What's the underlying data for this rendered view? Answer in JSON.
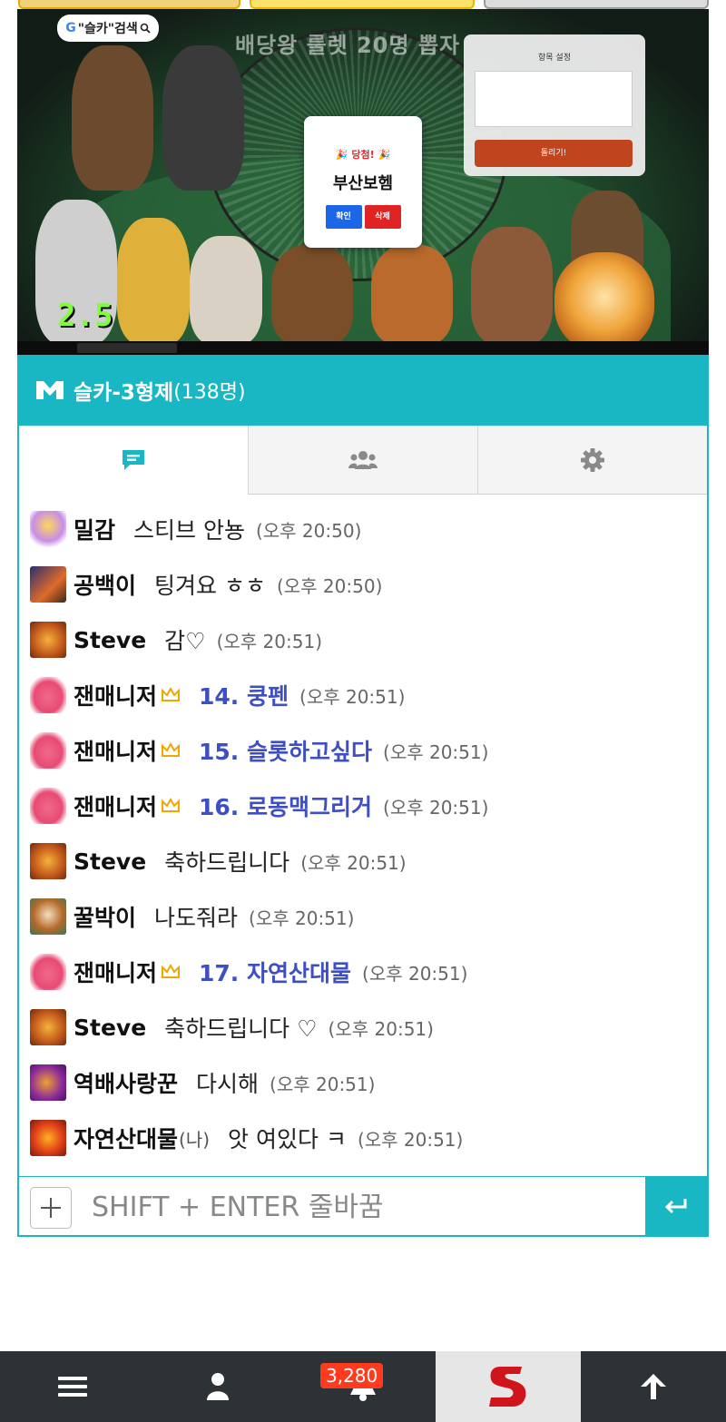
{
  "video": {
    "logo_text": "\"슬카\"검색",
    "logo_letter": "G",
    "title": "배당왕 룰렛 20명 뽑자",
    "settings_panel": {
      "title": "항목 설정",
      "list_preview": "",
      "button": "돌리기!"
    },
    "winner_modal": {
      "heading": "🎉 당첨! 🎉",
      "name": "부산보헴",
      "confirm_label": "확인",
      "delete_label": "삭제"
    },
    "speed": "2.5"
  },
  "chat_header": {
    "title": "슬카-3형제",
    "count": "(138명)"
  },
  "tabs": [
    {
      "name": "chat",
      "icon": "chat-bubble-icon",
      "active": true
    },
    {
      "name": "users",
      "icon": "users-icon",
      "active": false
    },
    {
      "name": "settings",
      "icon": "gear-icon",
      "active": false
    }
  ],
  "messages": [
    {
      "avatar": "egg-avatar",
      "nick": "밀감",
      "text": "스티브 안뇽",
      "time": "(오후 20:50)",
      "sys": false
    },
    {
      "avatar": "dog-avatar",
      "nick": "공백이",
      "text": "팅겨요 ㅎㅎ",
      "time": "(오후 20:50)",
      "sys": false
    },
    {
      "avatar": "lion-avatar",
      "nick": "Steve",
      "text": "감♡",
      "time": "(오후 20:51)",
      "sys": false
    },
    {
      "avatar": "pig-avatar",
      "nick": "잰매니저",
      "crown": true,
      "text": "14. 쿵펜",
      "time": "(오후 20:51)",
      "sys": true
    },
    {
      "avatar": "pig-avatar",
      "nick": "잰매니저",
      "crown": true,
      "text": "15. 슬롯하고싶다",
      "time": "(오후 20:51)",
      "sys": true
    },
    {
      "avatar": "pig-avatar",
      "nick": "잰매니저",
      "crown": true,
      "text": "16. 로동맥그리거",
      "time": "(오후 20:51)",
      "sys": true
    },
    {
      "avatar": "lion-avatar",
      "nick": "Steve",
      "text": "축하드립니다",
      "time": "(오후 20:51)",
      "sys": false
    },
    {
      "avatar": "beagle-avatar",
      "nick": "꿀박이",
      "text": "나도줘라",
      "time": "(오후 20:51)",
      "sys": false
    },
    {
      "avatar": "pig-avatar",
      "nick": "잰매니저",
      "crown": true,
      "text": "17. 자연산대물",
      "time": "(오후 20:51)",
      "sys": true
    },
    {
      "avatar": "lion-avatar",
      "nick": "Steve",
      "text": "축하드립니다 ♡",
      "time": "(오후 20:51)",
      "sys": false
    },
    {
      "avatar": "dragon-avatar",
      "nick": "역배사랑꾼",
      "text": "다시해",
      "time": "(오후 20:51)",
      "sys": false
    },
    {
      "avatar": "fire-avatar",
      "nick": "자연산대물",
      "me": "(나)",
      "text": "앗 여있다 ㅋ",
      "time": "(오후 20:51)",
      "sys": false
    }
  ],
  "input": {
    "placeholder": "SHIFT + ENTER 줄바꿈"
  },
  "bottom_nav": {
    "items": [
      "menu-icon",
      "user-icon",
      "bell-icon",
      "site-logo",
      "arrow-up-icon"
    ],
    "notification_count": "3,280"
  },
  "colors": {
    "accent": "#19b6c4",
    "system_text": "#3e4fc4",
    "nav_bg": "#2d3237",
    "badge": "#ff3b1f"
  }
}
